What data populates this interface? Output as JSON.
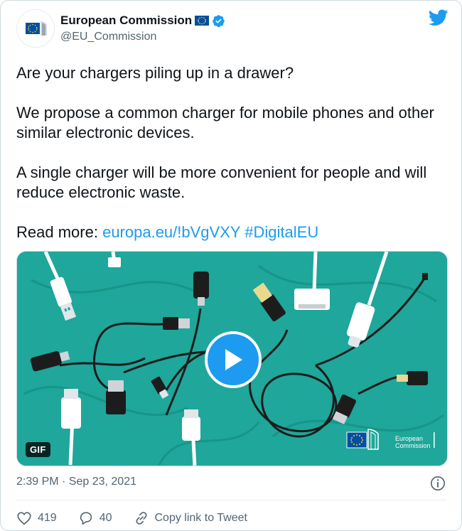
{
  "account": {
    "display_name": "European Commission",
    "handle": "@EU_Commission",
    "verified": true,
    "flag_icon": "eu-flag-icon",
    "avatar_icon": "european-commission-logo"
  },
  "tweet": {
    "paragraphs": [
      "Are your chargers piling up in a drawer?",
      "We propose a common charger for mobile phones and other similar electronic devices.",
      "A single charger will be more convenient for people and will reduce electronic waste."
    ],
    "read_more_label": "Read more:",
    "link_text": "europa.eu/!bVgVXY",
    "hashtag": "#DigitalEU"
  },
  "media": {
    "badge": "GIF",
    "brand_line1": "European",
    "brand_line2": "Commission",
    "background_color": "#1ea79a"
  },
  "meta": {
    "timestamp": "2:39 PM · Sep 23, 2021"
  },
  "actions": {
    "likes": "419",
    "replies": "40",
    "copy_link": "Copy link to Tweet"
  },
  "colors": {
    "accent": "#1d9bf0",
    "text": "#0f1419",
    "secondary": "#536471",
    "heart": "#536471"
  }
}
